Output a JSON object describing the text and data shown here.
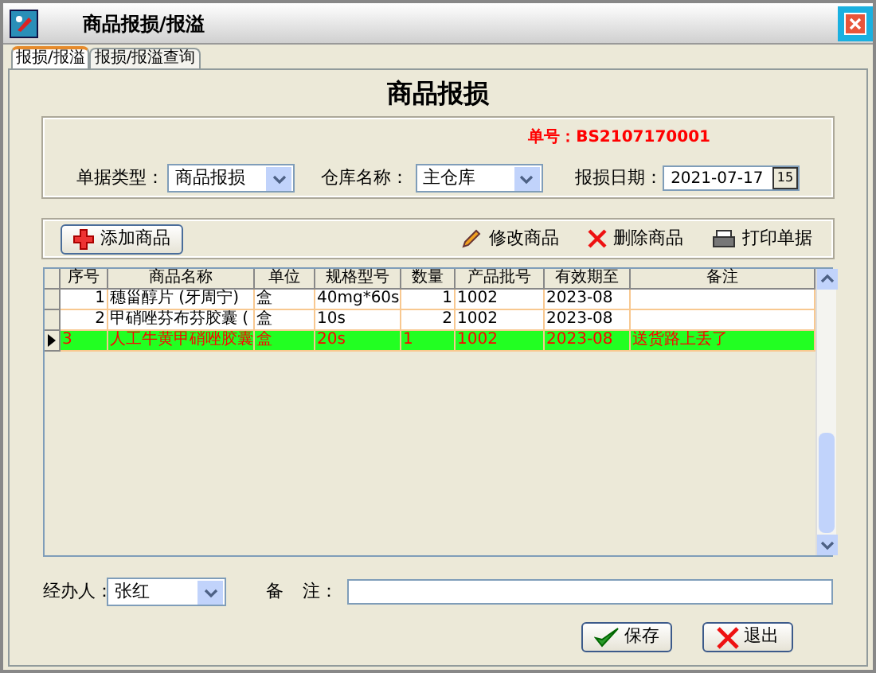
{
  "window": {
    "title": "商品报损/报溢"
  },
  "tabs": [
    {
      "label": "报损/报溢",
      "selected": true
    },
    {
      "label": "报损/报溢查询",
      "selected": false
    }
  ],
  "heading": "商品报损",
  "order_number": "单号：BS2107170001",
  "form": {
    "type_label": "单据类型：",
    "type_value": "商品报损",
    "warehouse_label": "仓库名称：",
    "warehouse_value": "主仓库",
    "date_label": "报损日期：",
    "date_value": "2021-07-17",
    "calendar_button": "15"
  },
  "toolbar": [
    {
      "kind": "add",
      "label": "添加商品"
    },
    {
      "kind": "edit",
      "label": "修改商品"
    },
    {
      "kind": "delete",
      "label": "删除商品"
    },
    {
      "kind": "print",
      "label": "打印单据"
    }
  ],
  "table": {
    "columns": [
      "序号",
      "商品名称",
      "单位",
      "规格型号",
      "数量",
      "产品批号",
      "有效期至",
      "备注"
    ],
    "rows": [
      {
        "cells": [
          "1",
          "穗甾醇片 (牙周宁)",
          "盒",
          "40mg*60s",
          "1",
          "1002",
          "2023-08",
          ""
        ],
        "selected": false
      },
      {
        "cells": [
          "2",
          "甲硝唑芬布芬胶囊 (",
          "盒",
          "10s",
          "2",
          "1002",
          "2023-08",
          ""
        ],
        "selected": false
      },
      {
        "cells": [
          "3",
          "人工牛黄甲硝唑胶囊",
          "盒",
          "20s",
          "1",
          "1002",
          "2023-08",
          "送货路上丢了"
        ],
        "selected": true
      }
    ]
  },
  "handler": {
    "label": "经办人：",
    "value": "张红"
  },
  "remark": {
    "label_1": "备",
    "label_2": "注："
  },
  "buttons": [
    {
      "kind": "save",
      "label": "保存"
    },
    {
      "kind": "exit",
      "label": "退出"
    }
  ]
}
